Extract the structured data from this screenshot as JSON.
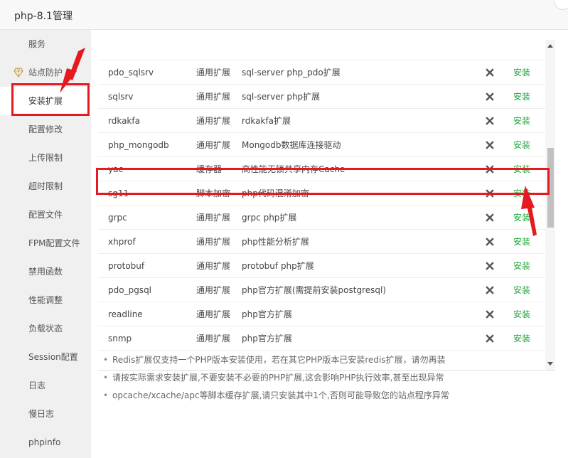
{
  "window": {
    "title": "php-8.1管理"
  },
  "sidebar": {
    "items": [
      {
        "label": "服务"
      },
      {
        "label": "站点防护",
        "icon": "diamond-icon"
      },
      {
        "label": "安装扩展",
        "active": true
      },
      {
        "label": "配置修改"
      },
      {
        "label": "上传限制"
      },
      {
        "label": "超时限制"
      },
      {
        "label": "配置文件"
      },
      {
        "label": "FPM配置文件"
      },
      {
        "label": "禁用函数"
      },
      {
        "label": "性能调整"
      },
      {
        "label": "负载状态"
      },
      {
        "label": "Session配置"
      },
      {
        "label": "日志"
      },
      {
        "label": "慢日志"
      },
      {
        "label": "phpinfo"
      }
    ]
  },
  "extensions": {
    "rows": [
      {
        "name": "pdo_sqlsrv",
        "type": "通用扩展",
        "desc": "sql-server php_pdo扩展",
        "action": "安装"
      },
      {
        "name": "sqlsrv",
        "type": "通用扩展",
        "desc": "sql-server php扩展",
        "action": "安装"
      },
      {
        "name": "rdkakfa",
        "type": "通用扩展",
        "desc": "rdkakfa扩展",
        "action": "安装"
      },
      {
        "name": "php_mongodb",
        "type": "通用扩展",
        "desc": "Mongodb数据库连接驱动",
        "action": "安装"
      },
      {
        "name": "yac",
        "type": "缓存器",
        "desc": "高性能无锁共享内存Cache",
        "action": "安装"
      },
      {
        "name": "sg11",
        "type": "脚本加密",
        "desc": "php代码混淆加密",
        "action": "安装"
      },
      {
        "name": "grpc",
        "type": "通用扩展",
        "desc": "grpc php扩展",
        "action": "安装"
      },
      {
        "name": "xhprof",
        "type": "通用扩展",
        "desc": "php性能分析扩展",
        "action": "安装"
      },
      {
        "name": "protobuf",
        "type": "通用扩展",
        "desc": "protobuf php扩展",
        "action": "安装"
      },
      {
        "name": "pdo_pgsql",
        "type": "通用扩展",
        "desc": "php官方扩展(需提前安装postgresql)",
        "action": "安装"
      },
      {
        "name": "readline",
        "type": "通用扩展",
        "desc": "php官方扩展",
        "action": "安装"
      },
      {
        "name": "snmp",
        "type": "通用扩展",
        "desc": "php官方扩展",
        "action": "安装"
      }
    ]
  },
  "tips": [
    "Redis扩展仅支持一个PHP版本安装使用，若在其它PHP版本已安装redis扩展，请勿再装",
    "请按实际需求安装扩展,不要安装不必要的PHP扩展,这会影响PHP执行效率,甚至出现异常",
    "opcache/xcache/apc等脚本缓存扩展,请只安装其中1个,否则可能导致您的站点程序异常"
  ],
  "colors": {
    "install": "#20a53a",
    "highlight": "#e5191f",
    "sidebar_bg": "#f0f0f0"
  }
}
